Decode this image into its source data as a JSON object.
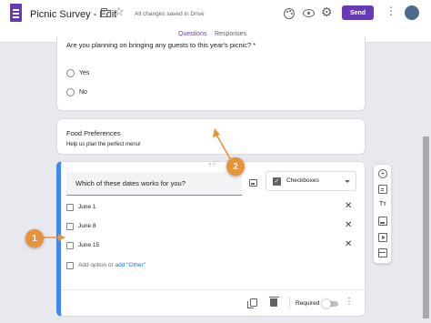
{
  "header": {
    "title": "Picnic Survey - Edit",
    "save_status": "All changes saved in Drive",
    "send_label": "Send",
    "tabs": [
      {
        "label": "Questions",
        "active": true
      },
      {
        "label": "Responses",
        "active": false
      }
    ],
    "accent_color": "#673ab7"
  },
  "question_guests": {
    "text": "Are you planning on bringing any guests to this year's picnic? *",
    "options": [
      "Yes",
      "No"
    ]
  },
  "section": {
    "title": "Food Preferences",
    "description": "Help us plan the perfect menu!"
  },
  "question_dates": {
    "text": "Which of these dates works for you?",
    "type_label": "Checkboxes",
    "options": [
      "June 1",
      "June 8",
      "June 15"
    ],
    "add_option": "Add option",
    "or_text": "or",
    "add_other": "add \"Other\"",
    "required_label": "Required",
    "required": false
  },
  "callouts": [
    "1",
    "2"
  ],
  "icons": {
    "app": "forms-doc-icon",
    "folder": "folder-icon",
    "star": "star-icon",
    "palette": "palette-icon",
    "preview": "eye-icon",
    "settings": "gear-icon",
    "more": "more-vert-icon"
  }
}
